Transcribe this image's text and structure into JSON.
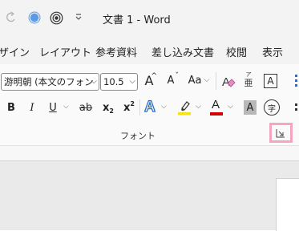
{
  "titlebar": {
    "title": "文書 1  -  Word",
    "undo_icon": "undo-icon",
    "autosave_icon": "autosave-dot-icon",
    "touch_icon": "touch-mode-icon",
    "customize_icon": "customize-qat-icon"
  },
  "menu": {
    "items": [
      "ザイン",
      "レイアウト",
      "参考資料",
      "差し込み文書",
      "校閲",
      "表示"
    ]
  },
  "font_group": {
    "font_name": "游明朝 (本文のフォン",
    "font_size": "10.5",
    "grow_label": "A",
    "shrink_label": "A",
    "case_label": "Aa",
    "ruby_top": "亜",
    "ruby_bottom": "ア",
    "border_char": "A",
    "bold": "B",
    "italic": "I",
    "underline": "U",
    "strike": "ab",
    "subscript": "x",
    "subscript_sub": "2",
    "superscript": "x",
    "superscript_sup": "2",
    "effects": "A",
    "highlight_color": "#f5e21a",
    "font_color_label": "A",
    "font_color": "#d40000",
    "shading_label": "A",
    "enclose_char": "字",
    "group_label": "フォント",
    "launcher_highlight": "#f4a6c0"
  }
}
